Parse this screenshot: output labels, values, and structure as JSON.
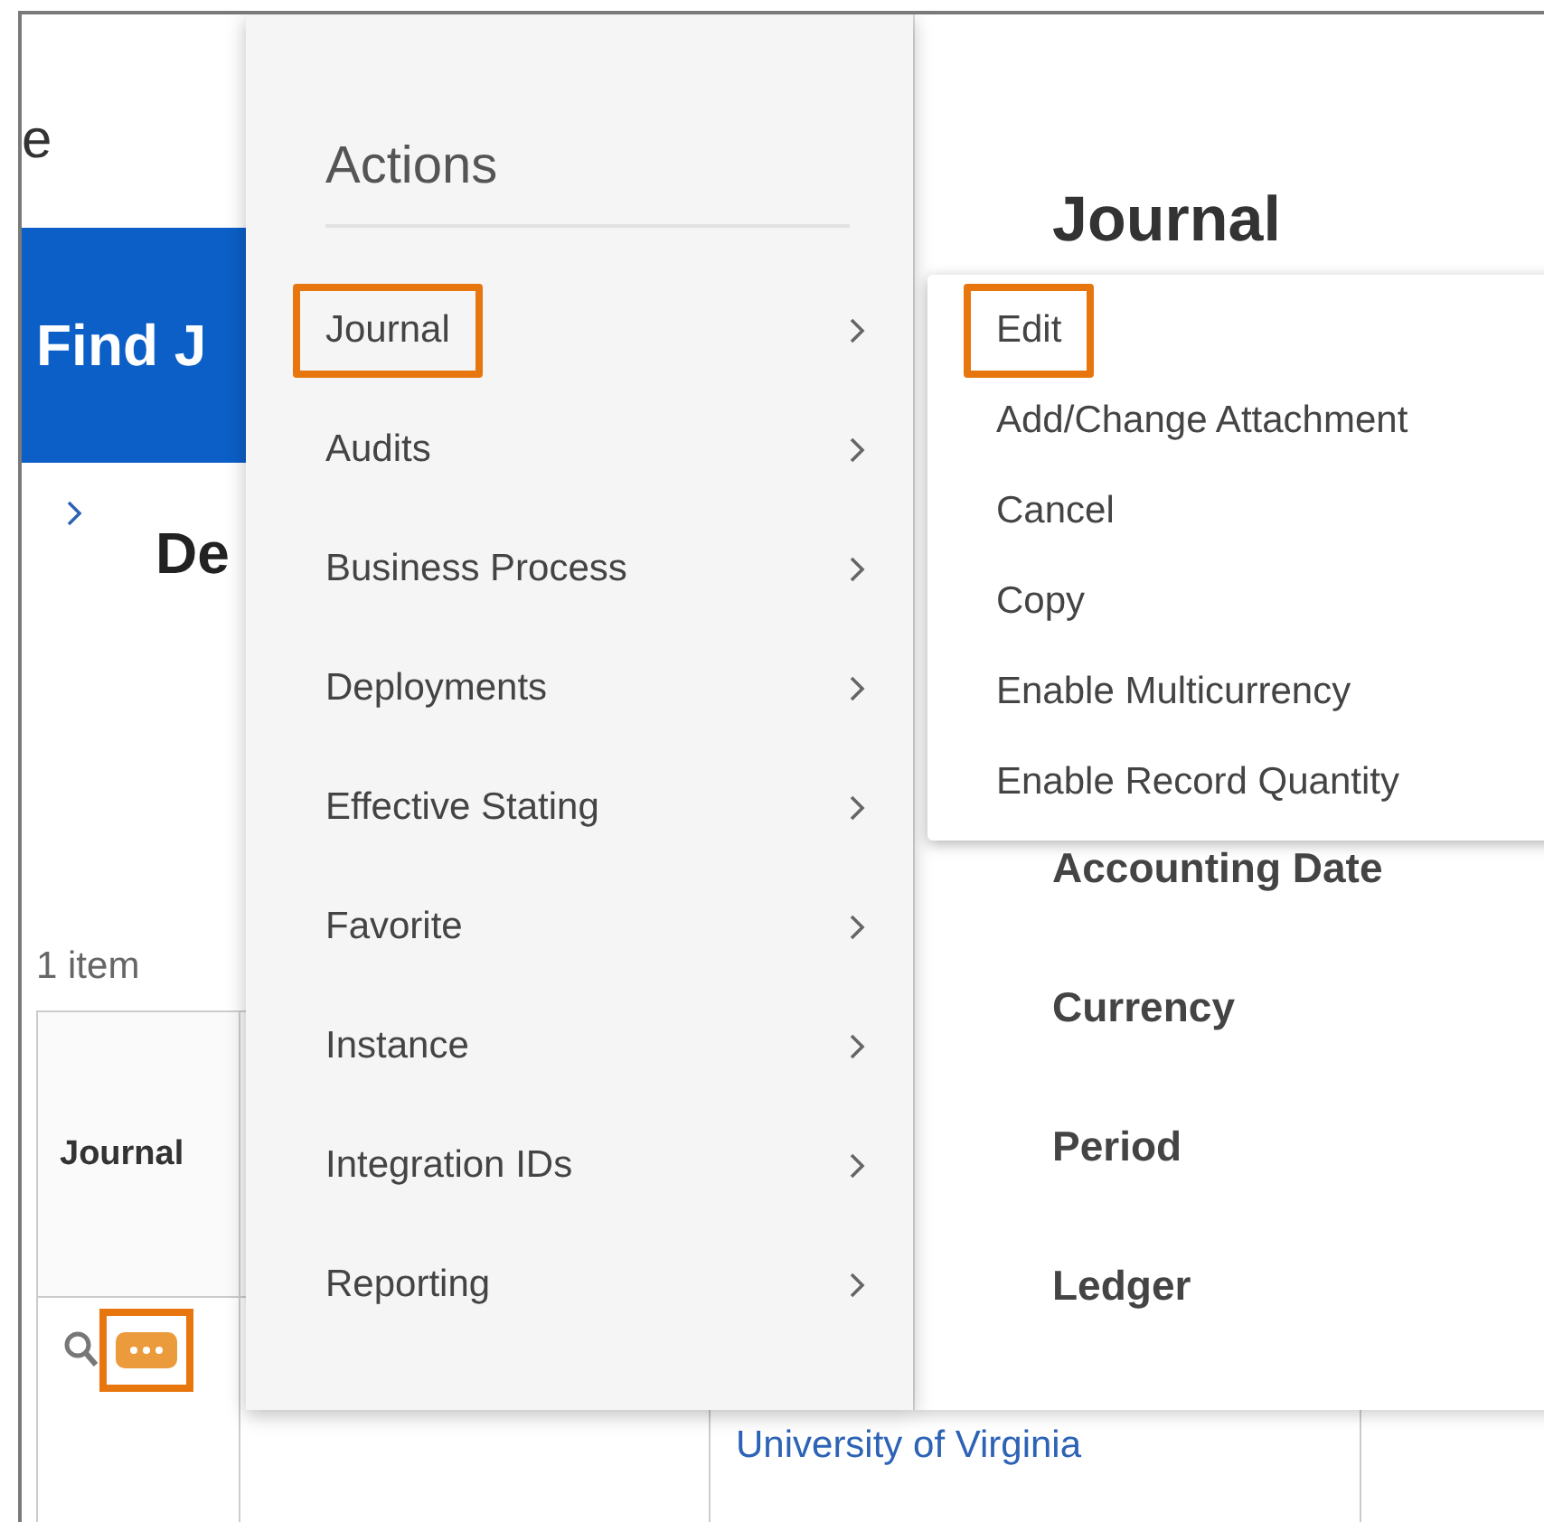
{
  "background_page": {
    "title_fragment": "e",
    "banner_title": "Find J",
    "section_title": "De",
    "item_count": "1 item",
    "table": {
      "columns": [
        "Journal"
      ],
      "rows": [
        {
          "more_highlighted": true,
          "column_3": "University of Virginia"
        }
      ]
    }
  },
  "actions_menu": {
    "title": "Actions",
    "items": [
      {
        "label": "Journal",
        "highlighted": true
      },
      {
        "label": "Audits",
        "highlighted": false
      },
      {
        "label": "Business Process",
        "highlighted": false
      },
      {
        "label": "Deployments",
        "highlighted": false
      },
      {
        "label": "Effective Stating",
        "highlighted": false
      },
      {
        "label": "Favorite",
        "highlighted": false
      },
      {
        "label": "Instance",
        "highlighted": false
      },
      {
        "label": "Integration IDs",
        "highlighted": false
      },
      {
        "label": "Reporting",
        "highlighted": false
      }
    ]
  },
  "submenu": {
    "items": [
      {
        "label": "Edit",
        "highlighted": true
      },
      {
        "label": "Add/Change Attachment",
        "highlighted": false
      },
      {
        "label": "Cancel",
        "highlighted": false
      },
      {
        "label": "Copy",
        "highlighted": false
      },
      {
        "label": "Enable Multicurrency",
        "highlighted": false
      },
      {
        "label": "Enable Record Quantity",
        "highlighted": false
      }
    ]
  },
  "details_panel": {
    "title": "Journal",
    "fields": [
      "Accounting Date",
      "Currency",
      "Period",
      "Ledger"
    ]
  }
}
